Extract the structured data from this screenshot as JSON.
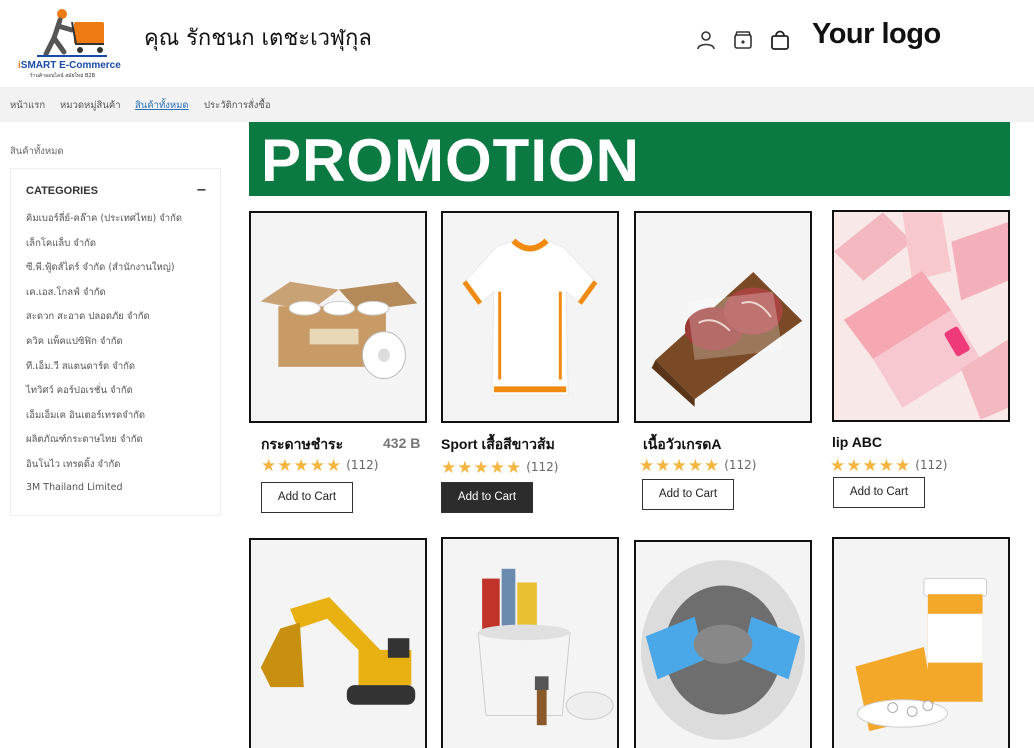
{
  "header": {
    "logo_brand_prefix": "i",
    "logo_brand": "SMART E-Commerce",
    "logo_tagline": "ร้านค้าออนไลน์ สมัยใหม่ B2B",
    "user_name": "คุณ รักชนก เตชะเวฬุกุล",
    "your_logo": "Your logo",
    "icons": [
      "user-icon",
      "store-icon",
      "shopping-bag-icon"
    ]
  },
  "nav": {
    "items": [
      {
        "label": "หน้าแรก",
        "active": false
      },
      {
        "label": "หมวดหมู่สินค้า",
        "active": false
      },
      {
        "label": "สินค้าทั้งหมด",
        "active": true
      },
      {
        "label": "ประวัติการสั่งซื้อ",
        "active": false
      }
    ]
  },
  "sidebar": {
    "breadcrumb": "สินค้าทั้งหมด",
    "categories_title": "CATEGORIES",
    "collapse_symbol": "−",
    "categories": [
      "คิมเบอร์ลี่ย์-คล๊าค (ประเทศไทย) จำกัด",
      "เล็กโคแล็บ จำกัด",
      "ซี.พี.ฟู้ดส์ไดร์ จำกัด (สำนักงานใหญ่)",
      "เค.เอส.โกลฟ์ จำกัด",
      "สะดวก สะอาด ปลอดภัย จำกัด",
      "ควิค แพ็คแปซิฟิก จำกัด",
      "ที.เอ็ม.วี สแตนดาร์ด จำกัด",
      "ไทวิศว์ คอร์ปอเรชั่น จำกัด",
      "เอ็มเอ็มเค อินเตอร์เทรดจำกัด",
      "ผลิตภัณฑ์กระดาษไทย จำกัด",
      "อินโนไว เทรดดิ้ง จำกัด",
      "3M Thailand Limited"
    ]
  },
  "banner": {
    "text": "PROMOTION",
    "color": "#0a7a42"
  },
  "products": [
    {
      "name": "กระดาษชำระ",
      "price": "432 B",
      "stars": "★★★★★",
      "reviews": "(112)",
      "button": "Add to Cart",
      "button_style": "light",
      "image": "toilet-paper-box-image"
    },
    {
      "name": "Sport เสื้อสีขาวส้ม",
      "price": "",
      "stars": "★★★★★",
      "reviews": "(112)",
      "button": "Add to Cart",
      "button_style": "dark",
      "image": "sport-shirt-image"
    },
    {
      "name": "เนื้อวัวเกรดA",
      "price": "",
      "stars": "★★★★★",
      "reviews": "(112)",
      "button": "Add to Cart",
      "button_style": "light",
      "image": "beef-image"
    },
    {
      "name": "lip ABC",
      "price": "",
      "stars": "★★★★★",
      "reviews": "(112)",
      "button": "Add to Cart",
      "button_style": "light",
      "image": "lip-product-image"
    },
    {
      "image": "excavator-image"
    },
    {
      "image": "paint-bucket-image"
    },
    {
      "image": "gravel-sack-image"
    },
    {
      "image": "medicine-bottles-image"
    }
  ]
}
